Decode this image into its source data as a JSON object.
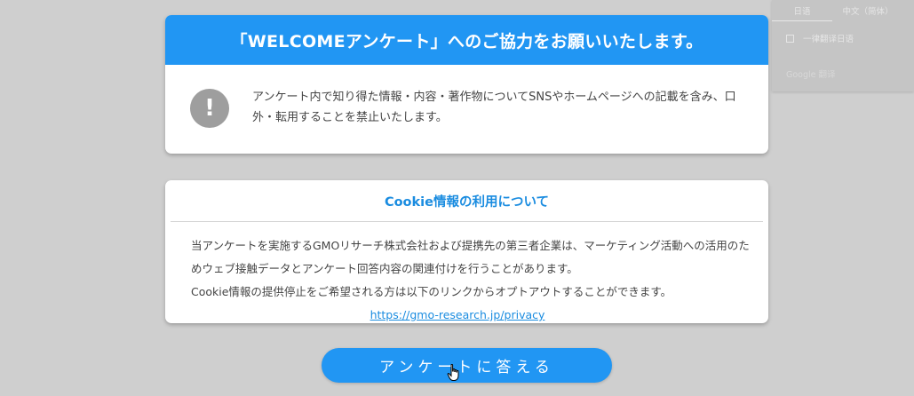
{
  "welcome": {
    "title": "「WELCOMEアンケート」へのご協力をお願いいたします。",
    "icon_glyph": "!",
    "notice": "アンケート内で知り得た情報・内容・著作物についてSNSやホームページへの記載を含み、口外・転用することを禁止いたします。"
  },
  "cookie": {
    "title": "Cookie情報の利用について",
    "paragraph1": "当アンケートを実施するGMOリサーチ株式会社および提携先の第三者企業は、マーケティング活動への活用のためウェブ接触データとアンケート回答内容の関連付けを行うことがあります。",
    "paragraph2": "Cookie情報の提供停止をご希望される方は以下のリンクからオプトアウトすることができます。",
    "link": "https://gmo-research.jp/privacy"
  },
  "answer_button": "アンケートに答える",
  "translate": {
    "tab_japanese": "日语",
    "tab_chinese": "中文（简体）",
    "option": "一律翻译日语",
    "footer": "Google 翻译"
  },
  "colors": {
    "accent": "#2196f3",
    "link": "#1a8ce0",
    "background": "#cfcfcf"
  }
}
